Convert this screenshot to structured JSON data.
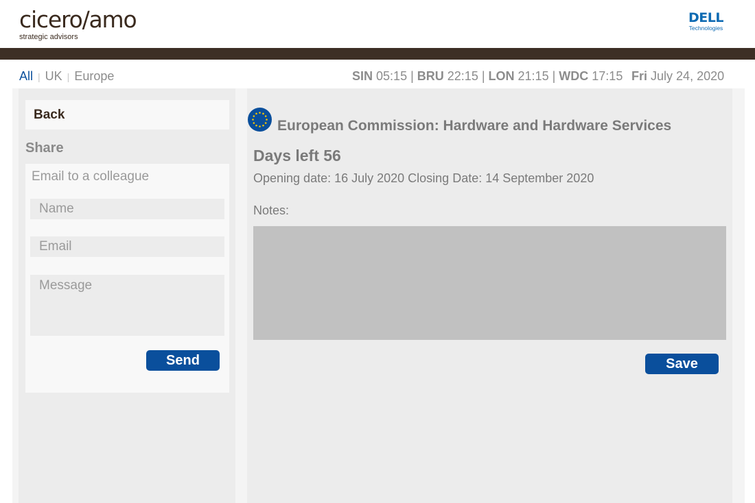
{
  "brand": {
    "logo_main": "cicero/amo",
    "logo_sub": "strategic advisors",
    "partner_word": "DELL",
    "partner_sub": "Technologies"
  },
  "nav": {
    "filters": [
      "All",
      "UK",
      "Europe"
    ],
    "active_filter": "All",
    "clocks": [
      {
        "city": "SIN",
        "time": "05:15"
      },
      {
        "city": "BRU",
        "time": "22:15"
      },
      {
        "city": "LON",
        "time": "21:15"
      },
      {
        "city": "WDC",
        "time": "17:15"
      }
    ],
    "date_day": "Fri",
    "date_rest": "July 24, 2020"
  },
  "sidebar": {
    "back_label": "Back",
    "share_title": "Share",
    "share_subtitle": "Email to a colleague",
    "name_placeholder": "Name",
    "email_placeholder": "Email",
    "message_placeholder": "Message",
    "send_label": "Send"
  },
  "detail": {
    "title": "European Commission: Hardware and Hardware Services",
    "days_left": "Days left 56",
    "dates": "Opening date: 16 July 2020 Closing Date: 14 September 2020",
    "notes_label": "Notes:",
    "notes_value": "",
    "save_label": "Save"
  },
  "colors": {
    "accent": "#0a4f9c",
    "brand_brown": "#3d2f25",
    "dell_blue": "#0f6bb3",
    "panel_gray": "#ececec",
    "notes_gray": "#c1c1c1",
    "eu_star": "#f5c400"
  },
  "icons": {
    "flag": "eu-flag-icon"
  }
}
